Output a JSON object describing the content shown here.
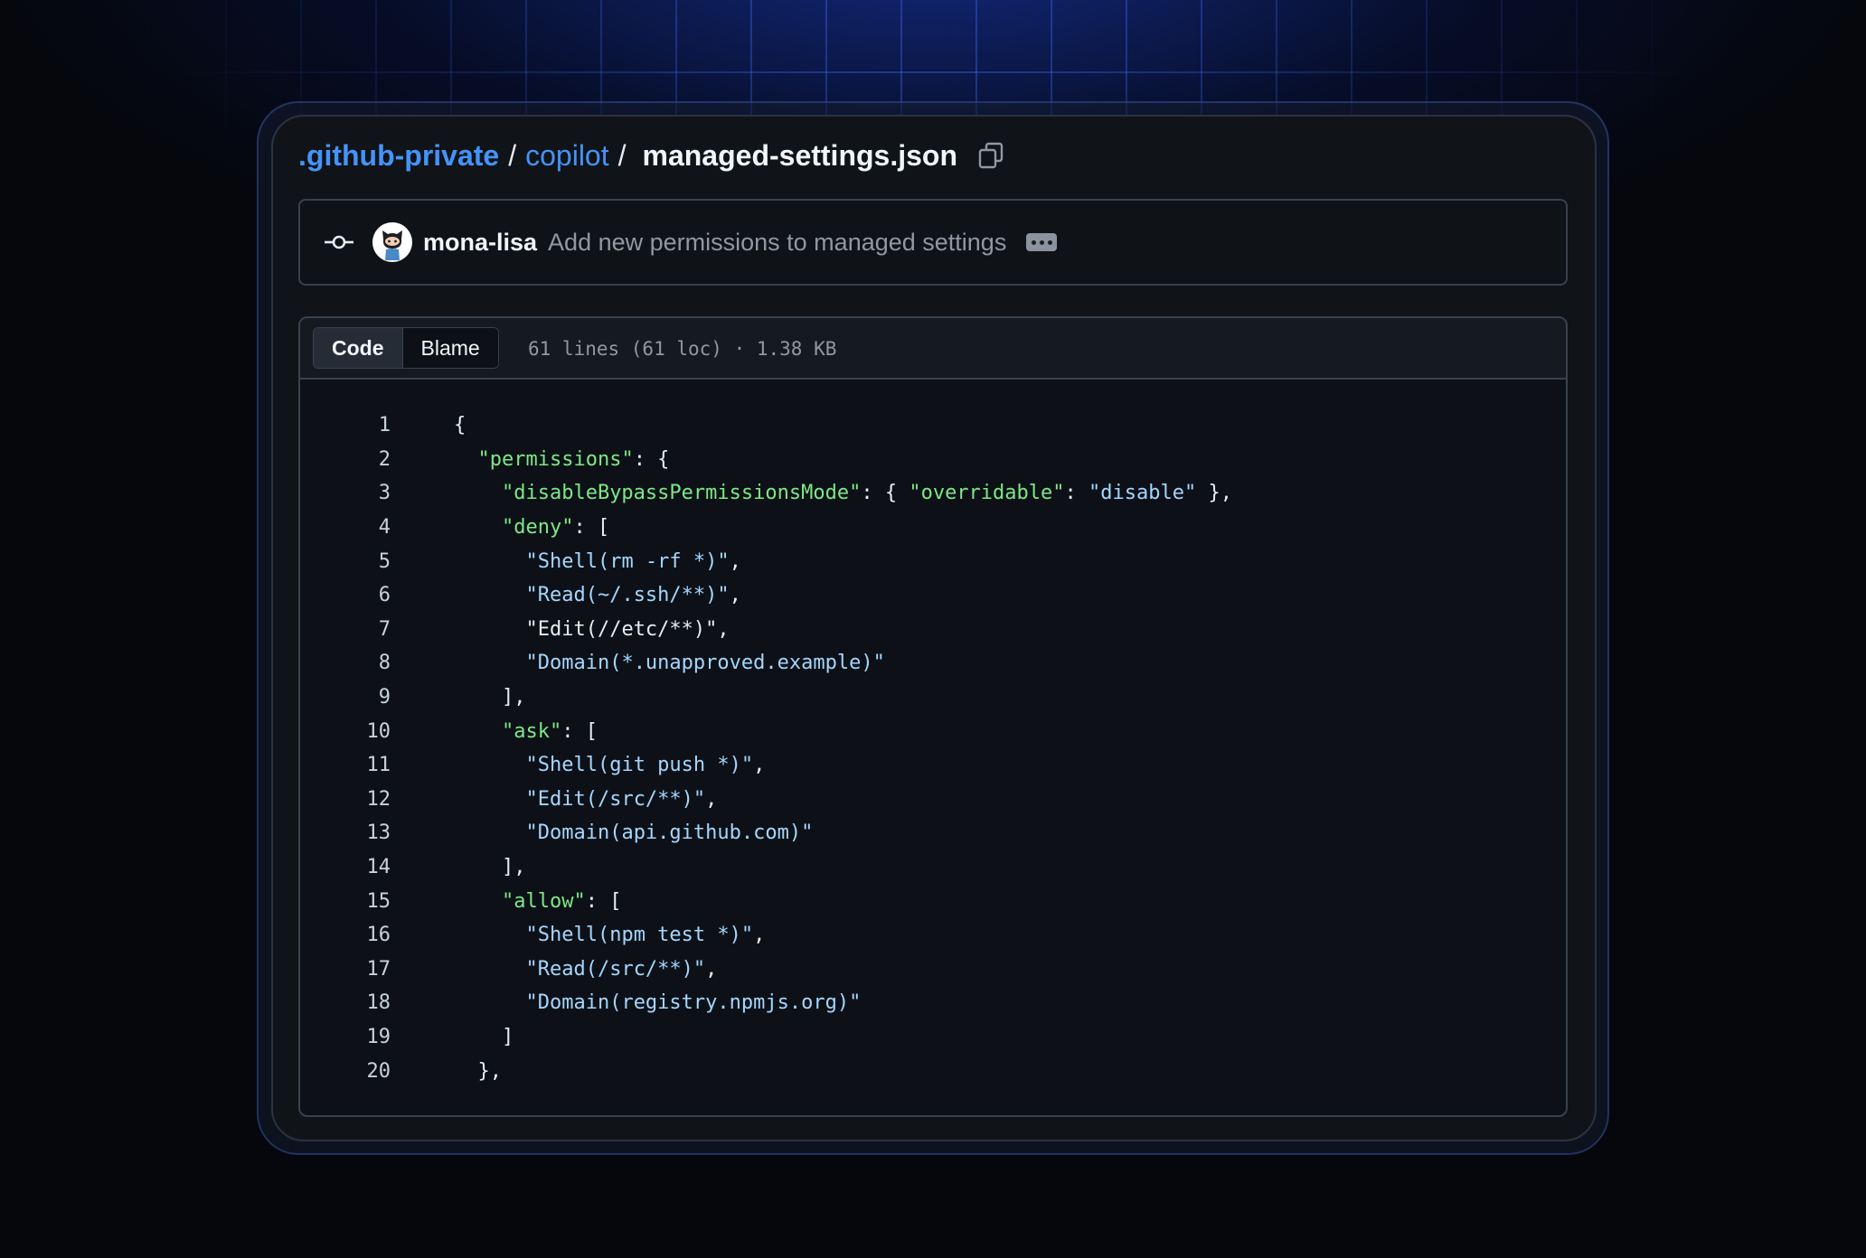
{
  "breadcrumb": {
    "org": ".github-private",
    "sep1": "/",
    "dir": "copilot",
    "sep2": "/",
    "file": "managed-settings.json"
  },
  "commit": {
    "author": "mona-lisa",
    "message": "Add new permissions to managed settings"
  },
  "file_header": {
    "tabs": [
      "Code",
      "Blame"
    ],
    "active_tab": "Code",
    "meta": "61 lines (61 loc) · 1.38 KB"
  },
  "code": [
    {
      "n": "1",
      "indent": "",
      "parts": [
        [
          "p",
          "{"
        ]
      ]
    },
    {
      "n": "2",
      "indent": "  ",
      "parts": [
        [
          "k",
          "\"permissions\""
        ],
        [
          "p",
          ": {"
        ]
      ]
    },
    {
      "n": "3",
      "indent": "    ",
      "parts": [
        [
          "k",
          "\"disableBypassPermissionsMode\""
        ],
        [
          "p",
          ": { "
        ],
        [
          "k",
          "\"overridable\""
        ],
        [
          "p",
          ": "
        ],
        [
          "s",
          "\"disable\""
        ],
        [
          "p",
          " },"
        ]
      ]
    },
    {
      "n": "4",
      "indent": "    ",
      "parts": [
        [
          "k",
          "\"deny\""
        ],
        [
          "p",
          ": ["
        ]
      ]
    },
    {
      "n": "5",
      "indent": "      ",
      "parts": [
        [
          "s",
          "\"Shell(rm -rf *)\""
        ],
        [
          "p",
          ","
        ]
      ]
    },
    {
      "n": "6",
      "indent": "      ",
      "parts": [
        [
          "s",
          "\"Read(~/.ssh/**)\""
        ],
        [
          "p",
          ","
        ]
      ]
    },
    {
      "n": "7",
      "indent": "      ",
      "parts": [
        [
          "p",
          "\"Edit(//etc/**)\""
        ],
        [
          "p",
          ","
        ]
      ]
    },
    {
      "n": "8",
      "indent": "      ",
      "parts": [
        [
          "s",
          "\"Domain(*.unapproved.example)\""
        ]
      ]
    },
    {
      "n": "9",
      "indent": "    ",
      "parts": [
        [
          "p",
          "],"
        ]
      ]
    },
    {
      "n": "10",
      "indent": "    ",
      "parts": [
        [
          "k",
          "\"ask\""
        ],
        [
          "p",
          ": ["
        ]
      ]
    },
    {
      "n": "11",
      "indent": "      ",
      "parts": [
        [
          "s",
          "\"Shell(git push *)\""
        ],
        [
          "p",
          ","
        ]
      ]
    },
    {
      "n": "12",
      "indent": "      ",
      "parts": [
        [
          "s",
          "\"Edit(/src/**)\""
        ],
        [
          "p",
          ","
        ]
      ]
    },
    {
      "n": "13",
      "indent": "      ",
      "parts": [
        [
          "s",
          "\"Domain(api.github.com)\""
        ]
      ]
    },
    {
      "n": "14",
      "indent": "    ",
      "parts": [
        [
          "p",
          "],"
        ]
      ]
    },
    {
      "n": "15",
      "indent": "    ",
      "parts": [
        [
          "k",
          "\"allow\""
        ],
        [
          "p",
          ": ["
        ]
      ]
    },
    {
      "n": "16",
      "indent": "      ",
      "parts": [
        [
          "s",
          "\"Shell(npm test *)\""
        ],
        [
          "p",
          ","
        ]
      ]
    },
    {
      "n": "17",
      "indent": "      ",
      "parts": [
        [
          "s",
          "\"Read(/src/**)\""
        ],
        [
          "p",
          ","
        ]
      ]
    },
    {
      "n": "18",
      "indent": "      ",
      "parts": [
        [
          "s",
          "\"Domain(registry.npmjs.org)\""
        ]
      ]
    },
    {
      "n": "19",
      "indent": "    ",
      "parts": [
        [
          "p",
          "]"
        ]
      ]
    },
    {
      "n": "20",
      "indent": "  ",
      "parts": [
        [
          "p",
          "},"
        ]
      ]
    }
  ],
  "icons": {
    "copy": "copy-icon",
    "commit": "git-commit-icon",
    "avatar": "octocat-avatar",
    "more": "ellipsis-icon"
  },
  "colors": {
    "link": "#4493f8",
    "key": "#7ee787",
    "string": "#a5d6ff",
    "text": "#e6edf3",
    "muted": "#9198a1"
  }
}
